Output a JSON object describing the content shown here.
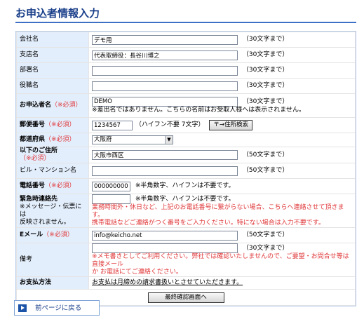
{
  "page_title": "お申込者情報入力",
  "required_mark": "（※必須）",
  "fields": {
    "company": {
      "label": "会社名",
      "value": "デモ用",
      "hint": "（30文字まで）"
    },
    "branch": {
      "label": "支店名",
      "value": "代表取締役：長谷川博之",
      "hint": "（30文字まで）"
    },
    "department": {
      "label": "部署名",
      "value": "",
      "hint": "（30文字まで）"
    },
    "position": {
      "label": "役職名",
      "value": "",
      "hint": "（30文字まで）"
    },
    "applicant": {
      "label": "お申込者名",
      "value": "DEMO",
      "hint": "（30文字まで）",
      "note": "※差出名ではありません。こちらの名前はお受取人様へは表示されません。"
    },
    "zip": {
      "label": "郵便番号",
      "value": "1234567",
      "hint": "（ハイフン不要 7文字）",
      "button": "〒→住所検索"
    },
    "prefecture": {
      "label": "都道府県",
      "value": "大阪府"
    },
    "address": {
      "label": "以下のご住所",
      "value": "大阪市西区",
      "hint": "（50文字まで）"
    },
    "building": {
      "label": "ビル・マンション名",
      "value": "",
      "hint": "（50文字まで）"
    },
    "phone": {
      "label": "電話番号",
      "value": "0000000000",
      "hint": "※半角数字、ハイフンは不要です。"
    },
    "emergency": {
      "label": "緊急時連絡先",
      "sublabel_1": "※メッセージ・伝票には",
      "sublabel_2": "反映されません。",
      "value": "",
      "hint": "※半角数字、ハイフンは不要です。",
      "note_1": "業務時間外・休日など、上記のお電話番号に繋がらない場合、こちらへ連絡させて頂きます。",
      "note_2": "携帯電話などご連絡がつく番号をご入力ください。特にない場合は入力不要です。"
    },
    "email": {
      "label": "Eメール",
      "value": "info@keicho.net",
      "hint": "（50文字まで）"
    },
    "remarks": {
      "label": "備考",
      "hint": "（30文字まで）",
      "note_1": "※メモ書きとしてご利用ください。弊社では確認いたしませんので、ご要望・お問合せ等は直接メール",
      "note_2": "か お電話にてご連絡ください。"
    },
    "payment": {
      "label": "お支払方法",
      "text": "お支払は月締めの請求書扱いとさせていただきます。"
    }
  },
  "submit_label": "最終確認画面へ",
  "back_label": "前ページに戻る",
  "colors": {
    "title": "#1a3f8a",
    "required": "#e0383a",
    "label_bg": "#e3eefc"
  }
}
